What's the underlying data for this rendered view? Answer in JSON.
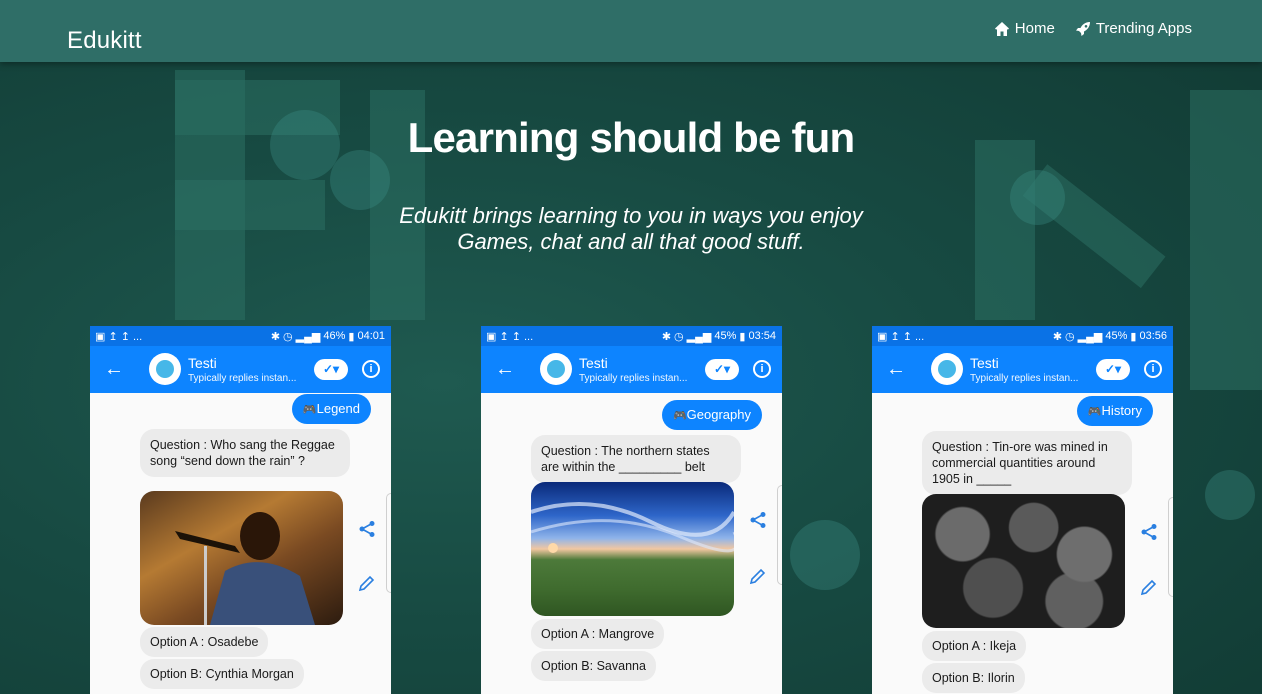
{
  "navbar": {
    "brand": "Edukitt",
    "links": [
      {
        "label": "Home",
        "icon": "home-icon"
      },
      {
        "label": "Trending Apps",
        "icon": "rocket-icon"
      }
    ]
  },
  "hero": {
    "title": "Learning should be fun",
    "subtitle_line1": "Edukitt brings learning to you in ways you enjoy",
    "subtitle_line2": "Games, chat and all that good stuff."
  },
  "phones": [
    {
      "status_left": "▣ ↥ ↥ ...",
      "battery": "46%",
      "time": "04:01",
      "bot_name": "Testi",
      "bot_status": "Typically replies instan...",
      "category": "Legend",
      "question": "Question : Who sang the Reggae song “send down the rain” ?",
      "options": [
        "Option A : Osadebe",
        "Option B: Cynthia Morgan"
      ]
    },
    {
      "status_left": "▣ ↥ ↥ ...",
      "battery": "45%",
      "time": "03:54",
      "bot_name": "Testi",
      "bot_status": "Typically replies instan...",
      "category": "Geography",
      "question": "Question : The northern states are within the _________ belt",
      "options": [
        "Option A : Mangrove",
        "Option B: Savanna"
      ]
    },
    {
      "status_left": "▣ ↥ ↥ ...",
      "battery": "45%",
      "time": "03:56",
      "bot_name": "Testi",
      "bot_status": "Typically replies instan...",
      "category": "History",
      "question": "Question : Tin-ore was mined in commercial quantities around 1905 in _____",
      "options": [
        "Option A : Ikeja",
        "Option B: Ilorin"
      ]
    }
  ],
  "colors": {
    "navbar": "#2f6e67",
    "messenger_blue": "#0d84ff",
    "status_blue": "#0a72e6"
  }
}
